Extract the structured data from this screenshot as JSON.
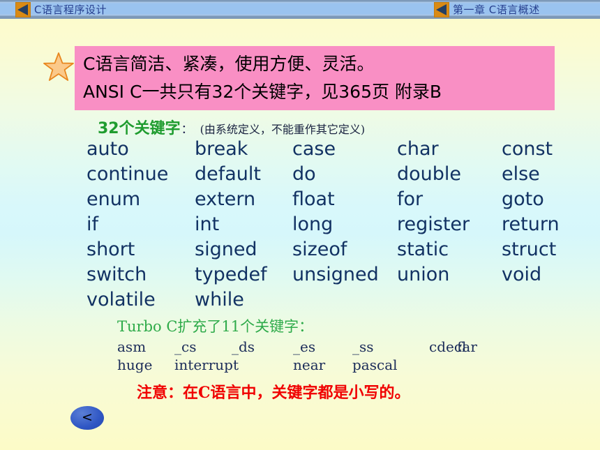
{
  "header": {
    "left_icon": "media-triangle-icon",
    "left_title": "C语言程序设计",
    "right_icon": "media-triangle-icon",
    "right_title": "第一章  C语言概述"
  },
  "callout": {
    "bullet_icon": "star-icon",
    "background_color": "#f98fc4",
    "line1": "C语言简洁、紧凑，使用方便、灵活。",
    "line2": "ANSI C一共只有32个关键字，见365页 附录B"
  },
  "keywords_section": {
    "heading_green": "32个关键字",
    "heading_colon": "：",
    "heading_note": "(由系统定义，不能重作其它定义)",
    "heading_green_color": "#1f9c2f",
    "keyword_color": "#123263",
    "rows": [
      [
        "auto",
        "break",
        "case",
        "char",
        "const"
      ],
      [
        "continue",
        "default",
        "do",
        "double",
        "else"
      ],
      [
        "enum",
        "extern",
        "float",
        "for",
        "goto"
      ],
      [
        "if",
        "int",
        "long",
        "register",
        "return"
      ],
      [
        "short",
        "signed",
        "sizeof",
        "static",
        "struct"
      ],
      [
        "switch",
        "typedef",
        "unsigned",
        "union",
        "void"
      ],
      [
        "volatile",
        "while",
        "",
        "",
        ""
      ]
    ]
  },
  "turbo_section": {
    "heading": "Turbo C扩充了11个关键字：",
    "heading_color": "#2fab4a",
    "rows": [
      [
        "asm",
        "_cs",
        "_ds",
        "_es",
        "_ss",
        "cdecl",
        "far"
      ],
      [
        "huge",
        "interrupt",
        "",
        "near",
        "pascal",
        "",
        ""
      ]
    ]
  },
  "note": {
    "text": "注意：在C语言中，关键字都是小写的。",
    "color": "#f00000"
  },
  "nav": {
    "back_icon": "chevron-left-icon",
    "back_label": "<"
  }
}
